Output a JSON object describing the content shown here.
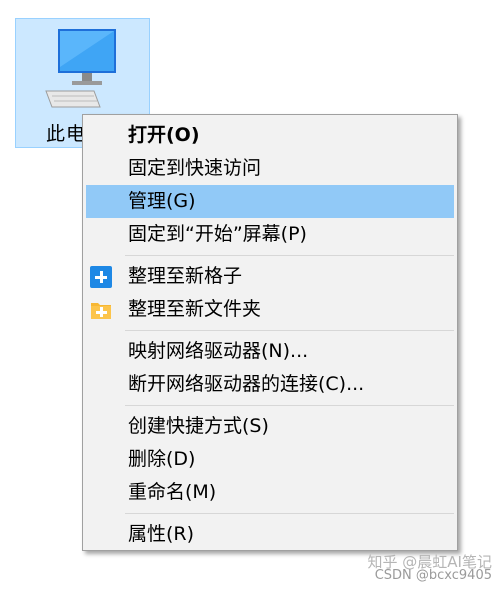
{
  "desktop": {
    "icon_label": "此电",
    "icon": "computer-icon"
  },
  "menu": {
    "items": [
      {
        "label": "打开(O)",
        "bold": true
      },
      {
        "label": "固定到快速访问"
      },
      {
        "label": "管理(G)",
        "highlighted": true
      },
      {
        "label": "固定到“开始”屏幕(P)"
      },
      {
        "label": "整理至新格子",
        "icon": "blue-plus-icon"
      },
      {
        "label": "整理至新文件夹",
        "icon": "folder-plus-icon"
      },
      {
        "label": "映射网络驱动器(N)..."
      },
      {
        "label": "断开网络驱动器的连接(C)..."
      },
      {
        "label": "创建快捷方式(S)"
      },
      {
        "label": "删除(D)"
      },
      {
        "label": "重命名(M)"
      },
      {
        "label": "属性(R)"
      }
    ]
  },
  "watermark": {
    "line1": "知乎 @晨虹AI笔记",
    "line2": "CSDN @bcxc9405"
  },
  "colors": {
    "highlight": "#91c9f7",
    "menu_bg": "#f2f2f2",
    "selected_icon_bg": "#cce8ff",
    "blue_icon": "#1e88e5",
    "folder_icon": "#f7b733"
  }
}
